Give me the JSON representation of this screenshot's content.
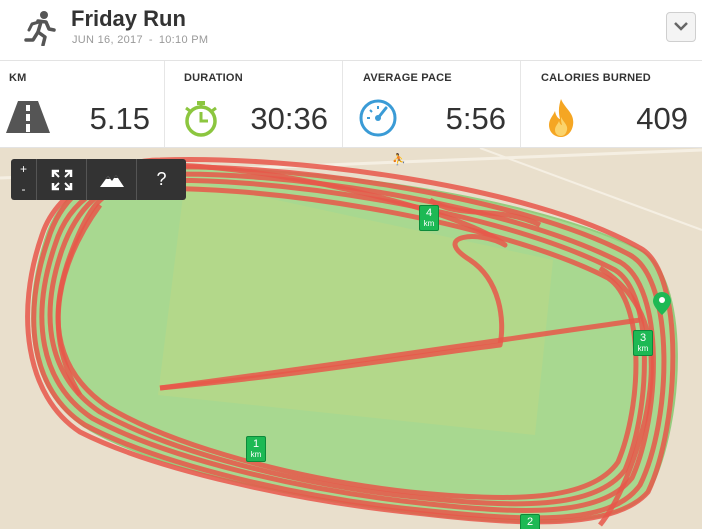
{
  "activity": {
    "title": "Friday Run",
    "date": "JUN 16, 2017",
    "separator": "-",
    "time": "10:10 PM"
  },
  "stats": [
    {
      "label": "KM",
      "value": "5.15",
      "icon": "road-icon"
    },
    {
      "label": "DURATION",
      "value": "30:36",
      "icon": "stopwatch-icon"
    },
    {
      "label": "AVERAGE PACE",
      "value": "5:56",
      "icon": "speedometer-icon"
    },
    {
      "label": "CALORIES BURNED",
      "value": "409",
      "icon": "flame-icon"
    }
  ],
  "map": {
    "controls": {
      "zoom_in": "+",
      "zoom_out": "-",
      "help": "?"
    },
    "km_markers": [
      {
        "num": "1",
        "unit": "km"
      },
      {
        "num": "2",
        "unit": "km"
      },
      {
        "num": "3",
        "unit": "km"
      },
      {
        "num": "4",
        "unit": "km"
      }
    ]
  },
  "colors": {
    "route": "#e8574a",
    "field": "#b3d88a",
    "track": "#a5d98a",
    "ground": "#e9dfcc",
    "marker": "#1db954"
  }
}
